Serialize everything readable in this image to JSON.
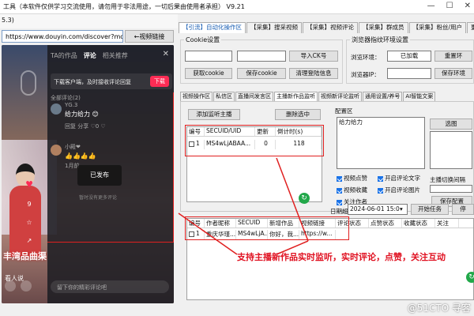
{
  "window": {
    "title": "工具（本软件仅供学习交流使用，请勿用于非法用途，一切后果由使用者承担）  V9.21",
    "version_label": "5.3)",
    "controls": [
      "—",
      "☐",
      "✕"
    ]
  },
  "browser": {
    "url": "https://www.douyin.com/discover?mo",
    "video_link_button": "←视频链接"
  },
  "phone": {
    "tabs": [
      "TA的作品",
      "评论",
      "相关推荐"
    ],
    "notice": "下载客户端，及时接收评论回复",
    "download_btn": "下载",
    "comment_count": "全部评论(2)",
    "comment1_user": "YG.3",
    "comment1_text": "给力给力 😊",
    "comment1_actions": "回复  分享  ♡0  ♡",
    "comment2_user": "小殿❤",
    "comment2_text": "👍👍👍👍",
    "comment2_date": "1月前",
    "published_toast": "已发布",
    "hint": "暂时没有更多评论",
    "input_placeholder": "留下你的精彩评论吧",
    "caption": "丰湾品曲渠",
    "caption2": "看人说",
    "side_counts": [
      "9",
      "☆",
      "↗"
    ]
  },
  "main_tabs": [
    "【引流】自动化操作区",
    "【采集】搜采视频",
    "【采集】视频评论",
    "【采集】群成员",
    "【采集】粉丝/用户",
    "更新"
  ],
  "cookie": {
    "group_title": "Cookie设置",
    "import_ck": "导入CK号",
    "get_cookie": "获取cookie",
    "save_cookie": "保存cookie",
    "clear_login": "清理登陆信息"
  },
  "browser_fp": {
    "group_title": "浏览器指纹环境设置",
    "env_label": "浏览环境：",
    "env_button": "已加载",
    "reset_env": "重置环",
    "ip_label": "浏览器IP：",
    "save_env": "保存环境"
  },
  "sub_tabs": [
    "视频操作区",
    "私信区",
    "直播间发言区",
    "主播新作品监听",
    "视频新评论监听",
    "通用设置/养号",
    "AI智能文案"
  ],
  "monitor": {
    "add_button": "添加监听主播",
    "delete_button": "删除选中",
    "columns": [
      "编号",
      "SECUID/UID",
      "更新",
      "倒计时(s)"
    ],
    "rows": [
      {
        "id": "1",
        "uid": "MS4wLjABAA...",
        "updates": "0",
        "countdown": "118"
      }
    ]
  },
  "config": {
    "group_title": "配置区",
    "text": "给力给力",
    "select_button": "选图",
    "options": [
      {
        "label": "视频点赞",
        "checked": true
      },
      {
        "label": "开启评论文字",
        "checked": true
      },
      {
        "label": "视频收藏",
        "checked": true
      },
      {
        "label": "开启评论图片",
        "checked": true
      },
      {
        "label": "关注作者",
        "checked": true
      }
    ],
    "interval_label": "主播切换间隔",
    "interval_value": "",
    "save_config": "保存配置"
  },
  "date_row": {
    "label": "日期超",
    "date": "2024-06-01 15:0",
    "start": "开始任务",
    "stop": "停"
  },
  "works_table": {
    "columns": [
      "编号",
      "作者昵称",
      "SECUID",
      "新增作品",
      "视频链接",
      "评论状态",
      "点赞状态",
      "收藏状态",
      "关注"
    ],
    "rows": [
      {
        "id": "1",
        "nick": "重庆华瑾...",
        "secuid": "MS4wLjA...",
        "new": "你好，我...",
        "link": "https://w..."
      }
    ]
  },
  "annotation": "支持主播新作品实时监听，实时评论，点赞，关注互动",
  "watermark": "@51CTO 寻客",
  "colors": {
    "accent": "#1a5fb4",
    "highlight": "#e02020",
    "go": "#22a84a"
  }
}
